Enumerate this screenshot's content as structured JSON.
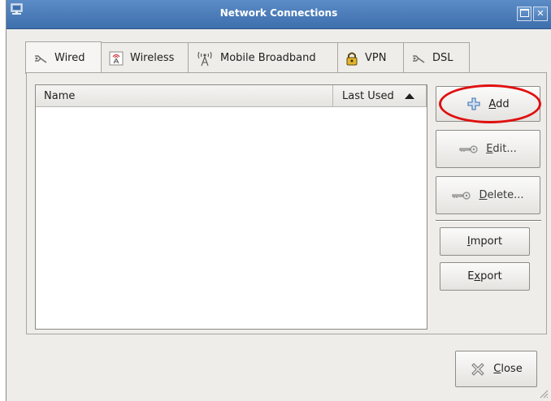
{
  "window": {
    "title": "Network Connections",
    "controls": [
      "restore-icon",
      "close-icon"
    ]
  },
  "tabs": [
    {
      "label": "Wired",
      "icon": "wired-plug-icon"
    },
    {
      "label": "Wireless",
      "icon": "wireless-antenna-icon"
    },
    {
      "label": "Mobile Broadband",
      "icon": "mobile-broadband-tower-icon"
    },
    {
      "label": "VPN",
      "icon": "vpn-lock-icon"
    },
    {
      "label": "DSL",
      "icon": "dsl-plug-icon"
    }
  ],
  "active_tab": "Wired",
  "list": {
    "columns": [
      "Name",
      "Last Used"
    ],
    "sort_column": "Last Used",
    "sort_direction": "ascending",
    "rows": []
  },
  "buttons": {
    "add": {
      "prefix": "",
      "mnemonic": "A",
      "rest": "dd",
      "icon": "plus-icon"
    },
    "edit": {
      "prefix": "",
      "mnemonic": "E",
      "rest": "dit...",
      "icon": "key-icon"
    },
    "delete": {
      "prefix": "",
      "mnemonic": "D",
      "rest": "elete...",
      "icon": "key-icon"
    },
    "import": {
      "prefix": "",
      "mnemonic": "I",
      "rest": "mport"
    },
    "export": {
      "prefix": "E",
      "mnemonic": "x",
      "rest": "port"
    },
    "close": {
      "prefix": "",
      "mnemonic": "C",
      "rest": "lose",
      "icon": "close-x-icon"
    }
  },
  "annotation": {
    "shape": "ellipse",
    "color": "#e01010",
    "target": "Add"
  },
  "colors": {
    "titlebar": "#4a7bb8",
    "window_bg": "#eeedea",
    "annotation": "#e01010"
  }
}
